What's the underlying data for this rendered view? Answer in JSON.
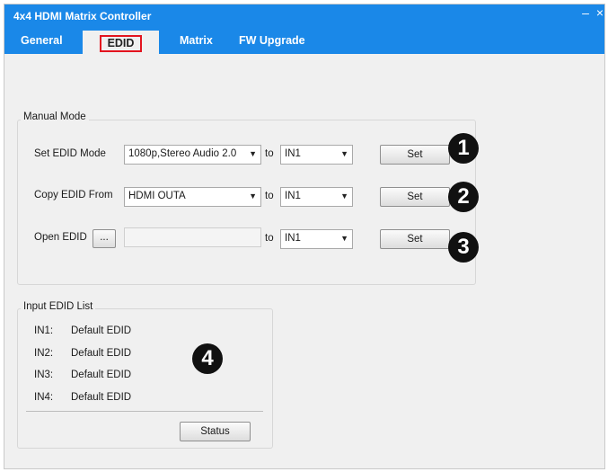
{
  "window": {
    "title": "4x4 HDMI Matrix Controller",
    "minimize_glyph": "–",
    "close_glyph": "×"
  },
  "tabs": [
    {
      "label": "General"
    },
    {
      "label": "EDID",
      "active": true
    },
    {
      "label": "Matrix"
    },
    {
      "label": "FW Upgrade"
    }
  ],
  "manual_mode": {
    "title": "Manual Mode",
    "to_label": "to",
    "rows": [
      {
        "label": "Set EDID Mode",
        "source_value": "1080p,Stereo Audio 2.0",
        "target_value": "IN1",
        "button": "Set",
        "marker": "1"
      },
      {
        "label": "Copy EDID From",
        "source_value": "HDMI OUTA",
        "target_value": "IN1",
        "button": "Set",
        "marker": "2"
      },
      {
        "label": "Open EDID",
        "browse_button": "...",
        "file_path": "",
        "target_value": "IN1",
        "button": "Set",
        "marker": "3"
      }
    ]
  },
  "input_edid_list": {
    "title": "Input EDID List",
    "items": [
      {
        "port": "IN1:",
        "value": "Default EDID"
      },
      {
        "port": "IN2:",
        "value": "Default EDID"
      },
      {
        "port": "IN3:",
        "value": "Default EDID"
      },
      {
        "port": "IN4:",
        "value": "Default EDID"
      }
    ],
    "status_button": "Status",
    "marker": "4"
  },
  "colors": {
    "titlebar": "#1a88e8",
    "tab_highlight": "#e3141f",
    "background": "#f0f0f0"
  }
}
